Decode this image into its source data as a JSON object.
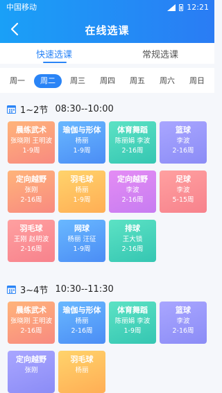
{
  "status": {
    "carrier": "中国移动",
    "time": "12:21"
  },
  "header": {
    "title": "在线选课"
  },
  "tabs": [
    {
      "label": "快速选课"
    },
    {
      "label": "常规选课"
    }
  ],
  "days": [
    {
      "label": "周一"
    },
    {
      "label": "周二"
    },
    {
      "label": "周三"
    },
    {
      "label": "周四"
    },
    {
      "label": "周五"
    },
    {
      "label": "周六"
    },
    {
      "label": "周日"
    }
  ],
  "selected_day": "周二",
  "sections": [
    {
      "label": "1~2节",
      "time": "08:30--10:00",
      "courses": [
        {
          "name": "晨练武术",
          "teacher": "张晓刚  王明波",
          "weeks": "1-9周",
          "color": "orange"
        },
        {
          "name": "瑜伽与形体",
          "teacher": "杨丽",
          "weeks": "1-9周",
          "color": "blue"
        },
        {
          "name": "体育舞蹈",
          "teacher": "陈丽娟  李波",
          "weeks": "2-16周",
          "color": "green"
        },
        {
          "name": "篮球",
          "teacher": "李波",
          "weeks": "2-16周",
          "color": "purple"
        },
        {
          "name": "定向越野",
          "teacher": "张刚",
          "weeks": "2-16周",
          "color": "orange"
        },
        {
          "name": "羽毛球",
          "teacher": "杨丽",
          "weeks": "1-9周",
          "color": "yellow"
        },
        {
          "name": "定向越野",
          "teacher": "李波",
          "weeks": "2-16周",
          "color": "magenta"
        },
        {
          "name": "足球",
          "teacher": "李波",
          "weeks": "5-15周",
          "color": "coral"
        },
        {
          "name": "羽毛球",
          "teacher": "王刚  赵明波",
          "weeks": "2-16周",
          "color": "coral"
        },
        {
          "name": "网球",
          "teacher": "杨丽  汪征",
          "weeks": "1-9周",
          "color": "blue"
        },
        {
          "name": "排球",
          "teacher": "王大锁",
          "weeks": "2-16周",
          "color": "green"
        }
      ]
    },
    {
      "label": "3~4节",
      "time": "10:30--11:30",
      "courses": [
        {
          "name": "晨练武术",
          "teacher": "张晓刚  王明波",
          "weeks": "2-16周",
          "color": "orange"
        },
        {
          "name": "瑜伽与形体",
          "teacher": "杨丽",
          "weeks": "2-16周",
          "color": "blue"
        },
        {
          "name": "体育舞蹈",
          "teacher": "陈丽娟  李波",
          "weeks": "1-9周",
          "color": "green"
        },
        {
          "name": "篮球",
          "teacher": "李波",
          "weeks": "2-16周",
          "color": "purple"
        },
        {
          "name": "定向越野",
          "teacher": "张刚",
          "weeks": "",
          "color": "purple"
        },
        {
          "name": "羽毛球",
          "teacher": "杨丽",
          "weeks": "",
          "color": "yellow"
        }
      ]
    }
  ]
}
